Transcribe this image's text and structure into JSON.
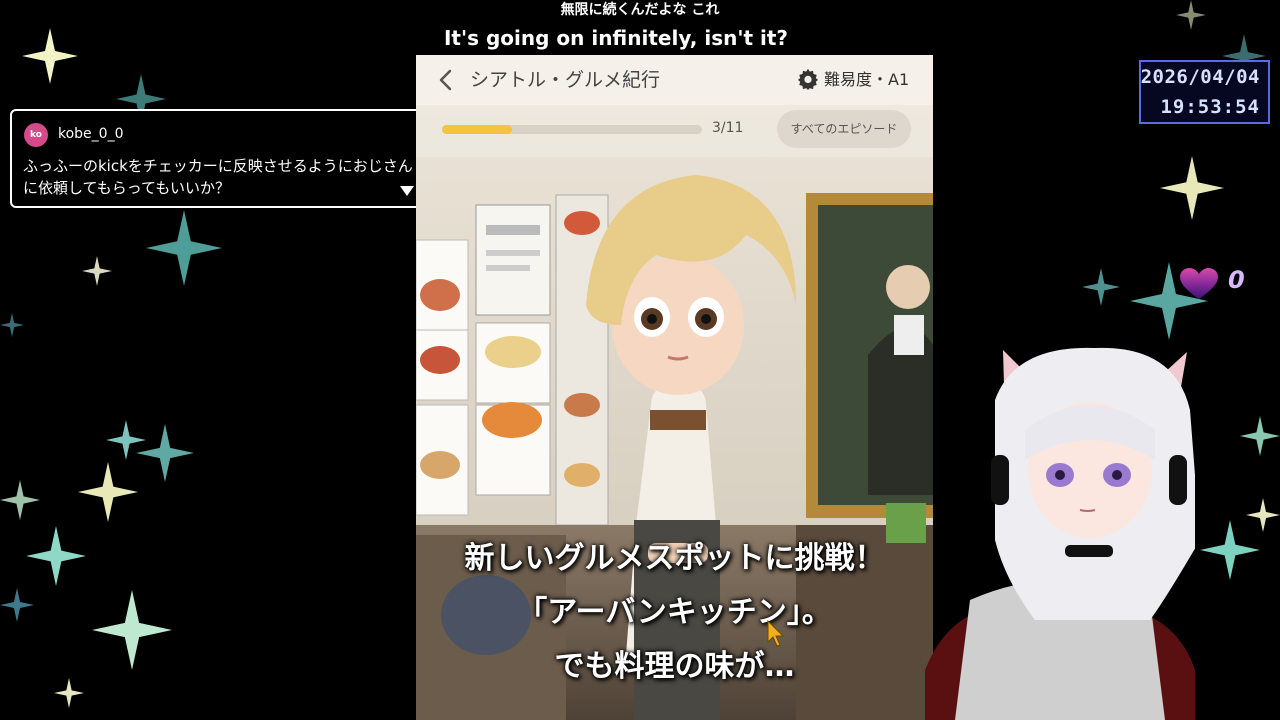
{
  "captions": {
    "japanese": "無限に続くんだよな これ",
    "english": "It's going on infinitely, isn't it?"
  },
  "chat": {
    "avatar_initials": "ko",
    "username": "kobe_0_0",
    "message": "ふっふーのkickをチェッカーに反映させるようにおじさんに依頼してもらってもいいか？"
  },
  "clock": {
    "date": "2026/04/04",
    "time": "19:53:54"
  },
  "hearts": {
    "count": "0"
  },
  "app": {
    "title": "シアトル・グルメ紀行",
    "difficulty": "難易度・A1",
    "progress_label": "3/11",
    "progress_value": 0.27,
    "episodes_button": "すべてのエピソード",
    "subtitle_lines": [
      "新しいグルメスポットに挑戦！",
      "「アーバンキッチン」。",
      "でも料理の味が…"
    ]
  },
  "colors": {
    "progress_fill": "#f2c440",
    "clock_border": "#5a6be0",
    "avatar_bg": "#d44a8a"
  }
}
